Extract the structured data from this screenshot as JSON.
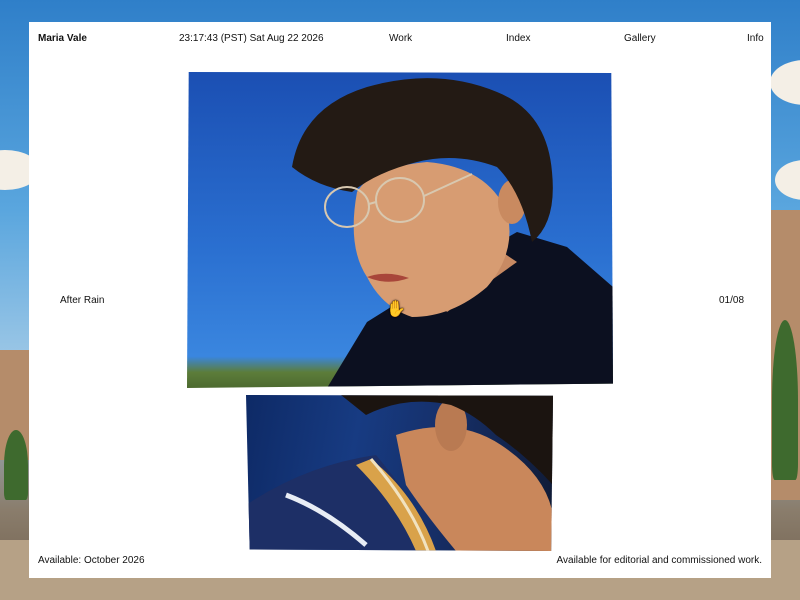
{
  "header": {
    "name": "Maria Vale",
    "datetime": "23:17:43 (PST) Sat Aug 22 2026",
    "nav": [
      "Work",
      "Index",
      "Gallery",
      "Info"
    ]
  },
  "viewer": {
    "title": "After Rain",
    "counter": "01/08"
  },
  "footer": {
    "availability": "Available: October 2026",
    "note": "Available for editorial and commissioned work."
  },
  "icons": {
    "cursor": "hand-pointer-icon"
  },
  "colors": {
    "frame": "#ffffff",
    "text": "#111111"
  }
}
